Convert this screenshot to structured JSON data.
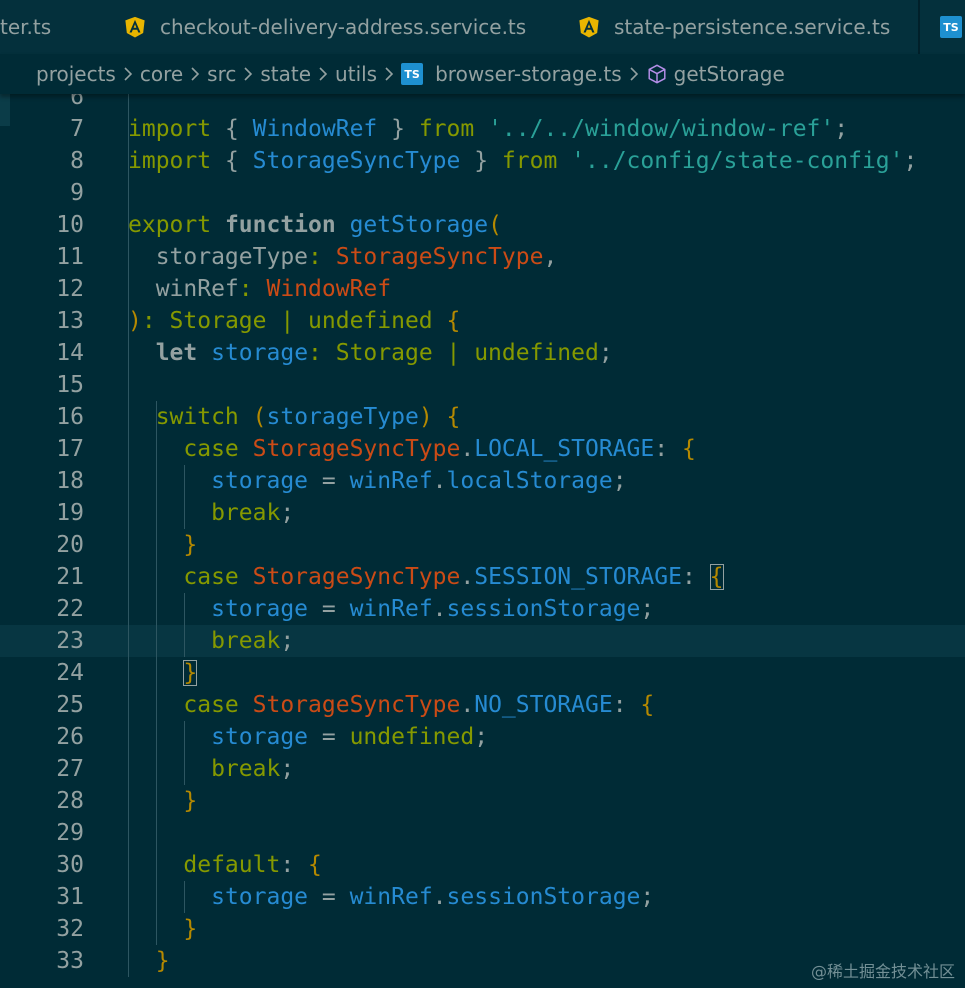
{
  "tabs": [
    {
      "label": "ter.ts",
      "icon": "typescript-file-icon"
    },
    {
      "label": "checkout-delivery-address.service.ts",
      "icon": "angular-icon"
    },
    {
      "label": "state-persistence.service.ts",
      "icon": "angular-icon"
    },
    {
      "label": "",
      "icon": "typescript-file-icon"
    }
  ],
  "ts_badge": "TS",
  "breadcrumb": [
    "projects",
    "core",
    "src",
    "state",
    "utils",
    "browser-storage.ts",
    "getStorage"
  ],
  "code_lines": [
    {
      "n": "6",
      "tokens": []
    },
    {
      "n": "7",
      "tokens": [
        [
          "kw",
          "import"
        ],
        [
          "pc",
          " { "
        ],
        [
          "id",
          "WindowRef"
        ],
        [
          "pc",
          " } "
        ],
        [
          "kw",
          "from"
        ],
        [
          "pc",
          " "
        ],
        [
          "str",
          "'../../window/window-ref'"
        ],
        [
          "pc",
          ";"
        ]
      ]
    },
    {
      "n": "8",
      "tokens": [
        [
          "kw",
          "import"
        ],
        [
          "pc",
          " { "
        ],
        [
          "id",
          "StorageSyncType"
        ],
        [
          "pc",
          " } "
        ],
        [
          "kw",
          "from"
        ],
        [
          "pc",
          " "
        ],
        [
          "str",
          "'../config/state-config'"
        ],
        [
          "pc",
          ";"
        ]
      ]
    },
    {
      "n": "9",
      "tokens": []
    },
    {
      "n": "10",
      "tokens": [
        [
          "kw",
          "export "
        ],
        [
          "pr bd",
          "function"
        ],
        [
          "pc",
          " "
        ],
        [
          "fn",
          "getStorage"
        ],
        [
          "br",
          "("
        ]
      ]
    },
    {
      "n": "11",
      "tokens": [
        [
          "pc",
          "  storageType"
        ],
        [
          "kw",
          ": "
        ],
        [
          "ty",
          "StorageSyncType"
        ],
        [
          "pc",
          ","
        ]
      ]
    },
    {
      "n": "12",
      "tokens": [
        [
          "pc",
          "  winRef"
        ],
        [
          "kw",
          ": "
        ],
        [
          "ty",
          "WindowRef"
        ]
      ]
    },
    {
      "n": "13",
      "tokens": [
        [
          "br",
          ")"
        ],
        [
          "kw",
          ": Storage | undefined "
        ],
        [
          "br",
          "{"
        ]
      ]
    },
    {
      "n": "14",
      "tokens": [
        [
          "pr bd",
          "  let"
        ],
        [
          "pc",
          " "
        ],
        [
          "id",
          "storage"
        ],
        [
          "kw",
          ": Storage | undefined"
        ],
        [
          "pc",
          ";"
        ]
      ]
    },
    {
      "n": "15",
      "tokens": []
    },
    {
      "n": "16",
      "tokens": [
        [
          "kw",
          "  switch"
        ],
        [
          "pc",
          " "
        ],
        [
          "br",
          "("
        ],
        [
          "id",
          "storageType"
        ],
        [
          "br",
          ")"
        ],
        [
          "pc",
          " "
        ],
        [
          "br",
          "{"
        ]
      ]
    },
    {
      "n": "17",
      "tokens": [
        [
          "kw",
          "    case"
        ],
        [
          "pc",
          " "
        ],
        [
          "ty",
          "StorageSyncType"
        ],
        [
          "pc",
          "."
        ],
        [
          "id",
          "LOCAL_STORAGE"
        ],
        [
          "pc",
          ": "
        ],
        [
          "br",
          "{"
        ]
      ]
    },
    {
      "n": "18",
      "tokens": [
        [
          "pc",
          "      "
        ],
        [
          "id",
          "storage"
        ],
        [
          "pc",
          " = "
        ],
        [
          "id",
          "winRef"
        ],
        [
          "pc",
          "."
        ],
        [
          "id",
          "localStorage"
        ],
        [
          "pc",
          ";"
        ]
      ]
    },
    {
      "n": "19",
      "tokens": [
        [
          "kw",
          "      break"
        ],
        [
          "pc",
          ";"
        ]
      ]
    },
    {
      "n": "20",
      "tokens": [
        [
          "br",
          "    }"
        ]
      ]
    },
    {
      "n": "21",
      "tokens": [
        [
          "kw",
          "    case"
        ],
        [
          "pc",
          " "
        ],
        [
          "ty",
          "StorageSyncType"
        ],
        [
          "pc",
          "."
        ],
        [
          "id",
          "SESSION_STORAGE"
        ],
        [
          "pc",
          ": "
        ],
        [
          "br box",
          "{"
        ]
      ]
    },
    {
      "n": "22",
      "tokens": [
        [
          "pc",
          "      "
        ],
        [
          "id",
          "storage"
        ],
        [
          "pc",
          " = "
        ],
        [
          "id",
          "winRef"
        ],
        [
          "pc",
          "."
        ],
        [
          "id",
          "sessionStorage"
        ],
        [
          "pc",
          ";"
        ]
      ]
    },
    {
      "n": "23",
      "tokens": [
        [
          "kw",
          "      break"
        ],
        [
          "pc",
          ";"
        ]
      ]
    },
    {
      "n": "24",
      "tokens": [
        [
          "pc",
          "    "
        ],
        [
          "br box",
          "}"
        ]
      ]
    },
    {
      "n": "25",
      "tokens": [
        [
          "kw",
          "    case"
        ],
        [
          "pc",
          " "
        ],
        [
          "ty",
          "StorageSyncType"
        ],
        [
          "pc",
          "."
        ],
        [
          "id",
          "NO_STORAGE"
        ],
        [
          "pc",
          ": "
        ],
        [
          "br",
          "{"
        ]
      ]
    },
    {
      "n": "26",
      "tokens": [
        [
          "pc",
          "      "
        ],
        [
          "id",
          "storage"
        ],
        [
          "pc",
          " = "
        ],
        [
          "kw",
          "undefined"
        ],
        [
          "pc",
          ";"
        ]
      ]
    },
    {
      "n": "27",
      "tokens": [
        [
          "kw",
          "      break"
        ],
        [
          "pc",
          ";"
        ]
      ]
    },
    {
      "n": "28",
      "tokens": [
        [
          "br",
          "    }"
        ]
      ]
    },
    {
      "n": "29",
      "tokens": []
    },
    {
      "n": "30",
      "tokens": [
        [
          "kw",
          "    default"
        ],
        [
          "pc",
          ": "
        ],
        [
          "br",
          "{"
        ]
      ]
    },
    {
      "n": "31",
      "tokens": [
        [
          "pc",
          "      "
        ],
        [
          "id",
          "storage"
        ],
        [
          "pc",
          " = "
        ],
        [
          "id",
          "winRef"
        ],
        [
          "pc",
          "."
        ],
        [
          "id",
          "sessionStorage"
        ],
        [
          "pc",
          ";"
        ]
      ]
    },
    {
      "n": "32",
      "tokens": [
        [
          "br",
          "    }"
        ]
      ]
    },
    {
      "n": "33",
      "tokens": [
        [
          "br",
          "  }"
        ]
      ]
    }
  ],
  "current_line": "23",
  "watermark": "@稀土掘金技术社区",
  "colors": {
    "background": "#002b36",
    "keyword": "#859900",
    "identifier": "#268bd2",
    "type": "#cb4b16",
    "string": "#2aa198",
    "bracket": "#b58900",
    "text": "#93a1a1",
    "angular": "#e8b500",
    "typescript": "#1e90d0"
  }
}
